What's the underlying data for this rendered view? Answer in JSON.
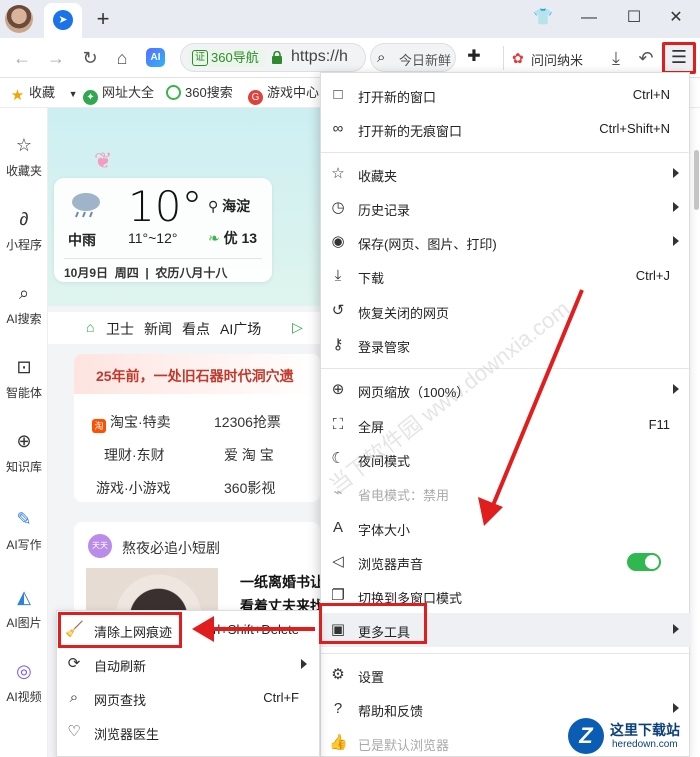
{
  "window": {
    "new_tab": "+",
    "controls": {
      "skin": "👕",
      "minimize": "—",
      "maximize": "☐",
      "close": "✕"
    }
  },
  "toolbar": {
    "site_name": "360导航",
    "url": "https://h",
    "search_placeholder": "今日新鲜",
    "wenwen": "问问纳米",
    "ai_badge": "AI"
  },
  "bookmarks": [
    {
      "label": "收藏",
      "icon": "star-icon"
    },
    {
      "label": "网址大全",
      "icon": "globe-icon"
    },
    {
      "label": "360搜索",
      "icon": "search-360-icon"
    },
    {
      "label": "游戏中心",
      "icon": "game-icon"
    }
  ],
  "sidebar": [
    {
      "label": "收藏夹",
      "icon": "☆"
    },
    {
      "label": "小程序",
      "icon": "∂"
    },
    {
      "label": "AI搜索",
      "icon": "⌕"
    },
    {
      "label": "智能体",
      "icon": "⊡"
    },
    {
      "label": "知识库",
      "icon": "⊕"
    },
    {
      "label": "AI写作",
      "icon": "✎"
    },
    {
      "label": "AI图片",
      "icon": "◭"
    },
    {
      "label": "AI视频",
      "icon": "◎"
    }
  ],
  "weather": {
    "condition": "中雨",
    "temp": "10°",
    "range": "11°~12°",
    "location": "海淀",
    "aqi": "优 13",
    "date": "10月9日",
    "weekday": "周四",
    "lunar": "农历八月十八"
  },
  "hero_nav": [
    "卫士",
    "新闻",
    "看点",
    "AI广场"
  ],
  "card_a": {
    "headline": "25年前，一处旧石器时代洞穴遗",
    "links": [
      "淘宝·特卖",
      "12306抢票",
      "理财·东财",
      "爱 淘 宝",
      "游戏·小游戏",
      "360影视"
    ]
  },
  "card_b": {
    "title": "熬夜必追小短剧",
    "line1": "一纸离婚书让",
    "line2": "看着丈夫来找"
  },
  "menu": {
    "items": [
      {
        "label": "打开新的窗口",
        "shortcut": "Ctrl+N",
        "icon": "□"
      },
      {
        "label": "打开新的无痕窗口",
        "shortcut": "Ctrl+Shift+N",
        "icon": "∞"
      },
      {
        "label": "收藏夹",
        "icon": "☆"
      },
      {
        "label": "历史记录",
        "icon": "◷"
      },
      {
        "label": "保存(网页、图片、打印)",
        "icon": "◉"
      },
      {
        "label": "下载",
        "shortcut": "Ctrl+J",
        "icon": "⤓"
      },
      {
        "label": "恢复关闭的网页",
        "icon": "↺"
      },
      {
        "label": "登录管家",
        "icon": "⚷"
      },
      {
        "label": "网页缩放（100%）",
        "icon": "⊕"
      },
      {
        "label": "全屏",
        "shortcut": "F11",
        "icon": "⛶"
      },
      {
        "label": "夜间模式",
        "icon": "☾"
      },
      {
        "label": "省电模式：禁用",
        "icon": "⌁"
      },
      {
        "label": "字体大小",
        "icon": "A"
      },
      {
        "label": "浏览器声音",
        "icon": "◁"
      },
      {
        "label": "切换到多窗口模式",
        "icon": "❐"
      },
      {
        "label": "更多工具",
        "icon": "▣"
      },
      {
        "label": "设置",
        "icon": "⚙"
      },
      {
        "label": "帮助和反馈",
        "icon": "?"
      },
      {
        "label": "已是默认浏览器",
        "icon": "👍"
      }
    ]
  },
  "submenu": {
    "items": [
      {
        "label": "清除上网痕迹",
        "shortcut": "Ctrl+Shift+Delete",
        "icon": "🧹"
      },
      {
        "label": "自动刷新",
        "icon": "⟳"
      },
      {
        "label": "网页查找",
        "shortcut": "Ctrl+F",
        "icon": "⌕"
      },
      {
        "label": "浏览器医生",
        "icon": "♡"
      }
    ]
  },
  "watermark": {
    "text": "当下软件园 www.downxia.com",
    "logo_title": "这里下载站",
    "logo_url": "heredown.com"
  },
  "colors": {
    "annotation_red": "#e01e1e",
    "toggle_on": "#2fb84f"
  }
}
